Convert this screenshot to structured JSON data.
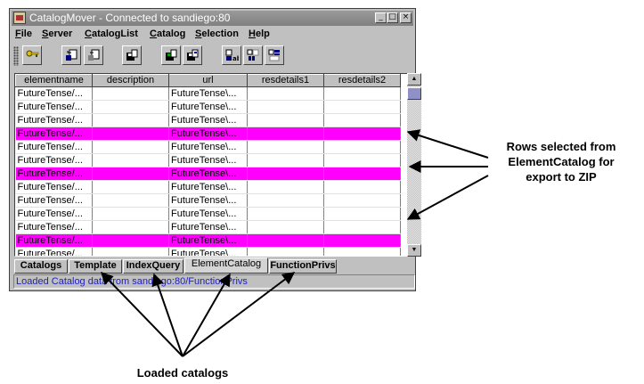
{
  "window": {
    "title": "CatalogMover - Connected to sandiego:80",
    "buttons": {
      "minimize": "_",
      "maximize": "□",
      "close": "×"
    }
  },
  "menubar": [
    {
      "label": "File",
      "mnemonic": "F",
      "rest": "ile"
    },
    {
      "label": "Server",
      "mnemonic": "S",
      "rest": "erver"
    },
    {
      "label": "CatalogList",
      "mnemonic": "C",
      "rest": "atalogList"
    },
    {
      "label": "Catalog",
      "mnemonic": "C",
      "rest": "atalog"
    },
    {
      "label": "Selection",
      "mnemonic": "S",
      "rest": "election"
    },
    {
      "label": "Help",
      "mnemonic": "H",
      "rest": "elp"
    }
  ],
  "toolbar": {
    "icons": [
      "connect-key-icon",
      "export-catalog-icon",
      "import-catalog-icon",
      "save-catalog-icon",
      "save-floppy-icon",
      "save-all-icon",
      "rename-field-icon",
      "column-icon",
      "list-select-icon"
    ]
  },
  "table": {
    "columns": [
      "elementname",
      "description",
      "url",
      "resdetails1",
      "resdetails2"
    ],
    "rows": [
      {
        "elementname": "FutureTense/...",
        "description": "",
        "url": "FutureTense\\...",
        "selected": false
      },
      {
        "elementname": "FutureTense/...",
        "description": "",
        "url": "FutureTense\\...",
        "selected": false
      },
      {
        "elementname": "FutureTense/...",
        "description": "",
        "url": "FutureTense\\...",
        "selected": false
      },
      {
        "elementname": "FutureTense/...",
        "description": "",
        "url": "FutureTense\\...",
        "selected": true
      },
      {
        "elementname": "FutureTense/...",
        "description": "",
        "url": "FutureTense\\...",
        "selected": false
      },
      {
        "elementname": "FutureTense/...",
        "description": "",
        "url": "FutureTense\\...",
        "selected": false
      },
      {
        "elementname": "FutureTense/...",
        "description": "",
        "url": "FutureTense\\...",
        "selected": true
      },
      {
        "elementname": "FutureTense/...",
        "description": "",
        "url": "FutureTense\\...",
        "selected": false
      },
      {
        "elementname": "FutureTense/...",
        "description": "",
        "url": "FutureTense\\...",
        "selected": false
      },
      {
        "elementname": "FutureTense/...",
        "description": "",
        "url": "FutureTense\\...",
        "selected": false
      },
      {
        "elementname": "FutureTense/...",
        "description": "",
        "url": "FutureTense\\...",
        "selected": false
      },
      {
        "elementname": "FutureTense/...",
        "description": "",
        "url": "FutureTense\\...",
        "selected": true
      },
      {
        "elementname": "FutureTense/...",
        "description": "",
        "url": "FutureTense\\...",
        "selected": false
      },
      {
        "elementname": "FutureTense/",
        "description": "",
        "url": "FutureTense\\",
        "selected": false
      }
    ]
  },
  "tabs": [
    {
      "label": "Catalogs",
      "active": false
    },
    {
      "label": "Template",
      "active": false
    },
    {
      "label": "IndexQuery",
      "active": false
    },
    {
      "label": "ElementCatalog",
      "active": true
    },
    {
      "label": "FunctionPrivs",
      "active": false
    }
  ],
  "status": "Loaded Catalog data from sandiego:80/FunctionPrivs",
  "annotations": {
    "rows_selected": [
      "Rows selected from",
      "ElementCatalog for",
      "export to ZIP"
    ],
    "loaded_catalogs": "Loaded catalogs"
  },
  "colors": {
    "selection": "#ff00ff",
    "status_text": "#2020c0",
    "window": "#c0c0c0"
  }
}
